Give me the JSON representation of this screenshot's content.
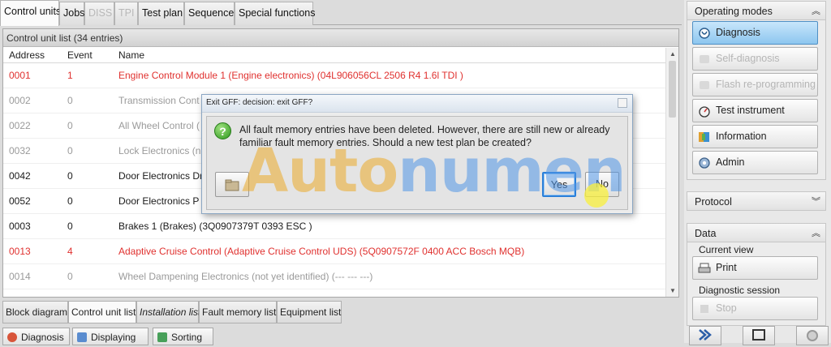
{
  "top_tabs": [
    {
      "label": "Control units",
      "state": "active"
    },
    {
      "label": "Jobs",
      "state": "normal"
    },
    {
      "label": "DISS",
      "state": "disabled"
    },
    {
      "label": "TPI",
      "state": "disabled"
    },
    {
      "label": "Test plan",
      "state": "normal"
    },
    {
      "label": "Sequence",
      "state": "normal"
    },
    {
      "label": "Special functions",
      "state": "normal"
    }
  ],
  "list": {
    "title": "Control unit list (34 entries)",
    "columns": {
      "address": "Address",
      "event": "Event",
      "name": "Name"
    },
    "rows": [
      {
        "address": "0001",
        "event": "1",
        "name": "Engine Control Module 1 (Engine electronics) (04L906056CL   2506   R4 1.6l TDI  )",
        "color": "#e0312f"
      },
      {
        "address": "0002",
        "event": "0",
        "name": "Transmission Cont",
        "color": "#9a9a9a"
      },
      {
        "address": "0022",
        "event": "0",
        "name": "All Wheel Control (",
        "color": "#9a9a9a"
      },
      {
        "address": "0032",
        "event": "0",
        "name": "Lock Electronics (n",
        "color": "#9a9a9a"
      },
      {
        "address": "0042",
        "event": "0",
        "name": "Door Electronics Dr",
        "color": "#1a1a1a"
      },
      {
        "address": "0052",
        "event": "0",
        "name": "Door Electronics P",
        "color": "#1a1a1a"
      },
      {
        "address": "0003",
        "event": "0",
        "name": "Brakes 1 (Brakes) (3Q0907379T    0393   ESC        )",
        "color": "#1a1a1a"
      },
      {
        "address": "0013",
        "event": "4",
        "name": "Adaptive Cruise Control (Adaptive Cruise Control UDS) (5Q0907572F    0400   ACC Bosch MQB)",
        "color": "#e0312f"
      },
      {
        "address": "0014",
        "event": "0",
        "name": "Wheel Dampening Electronics (not yet identified) (---    ---    ---)",
        "color": "#9a9a9a"
      }
    ]
  },
  "bottom_tabs": [
    {
      "label": "Block diagram",
      "state": "normal"
    },
    {
      "label": "Control unit list",
      "state": "active"
    },
    {
      "label": "Installation list",
      "state": "italic"
    },
    {
      "label": "Fault memory list",
      "state": "normal"
    },
    {
      "label": "Equipment list",
      "state": "normal"
    }
  ],
  "status_buttons": [
    {
      "label": "Diagnosis",
      "icon": "stethoscope-icon"
    },
    {
      "label": "Displaying",
      "icon": "display-icon"
    },
    {
      "label": "Sorting",
      "icon": "sort-icon"
    }
  ],
  "sidebar": {
    "operating_modes": {
      "title": "Operating modes",
      "buttons": [
        {
          "label": "Diagnosis",
          "state": "active",
          "icon": "stethoscope-icon"
        },
        {
          "label": "Self-diagnosis",
          "state": "disabled",
          "icon": "self-diagnosis-icon"
        },
        {
          "label": "Flash re-programming",
          "state": "disabled",
          "icon": "flash-icon"
        },
        {
          "label": "Test instrument",
          "state": "normal",
          "icon": "gauge-icon"
        },
        {
          "label": "Information",
          "state": "normal",
          "icon": "information-icon"
        },
        {
          "label": "Admin",
          "state": "normal",
          "icon": "admin-icon"
        }
      ]
    },
    "protocol": {
      "title": "Protocol"
    },
    "data": {
      "title": "Data",
      "current_view": "Current view",
      "print_label": "Print",
      "diagnostic_session": "Diagnostic session",
      "stop_label": "Stop"
    }
  },
  "dialog": {
    "title": "Exit GFF: decision: exit GFF?",
    "message": "All fault memory entries have been deleted. However, there are still new or already familiar fault memory entries. Should a new test plan be created?",
    "yes_label": "Yes",
    "no_label": "No",
    "icon": "question-icon"
  },
  "watermark": {
    "part1": "Auto",
    "part2": "numen"
  },
  "colors": {
    "accent": "#2a7fd9",
    "error_red": "#e0312f",
    "active_blue": "#8dc6ef"
  }
}
